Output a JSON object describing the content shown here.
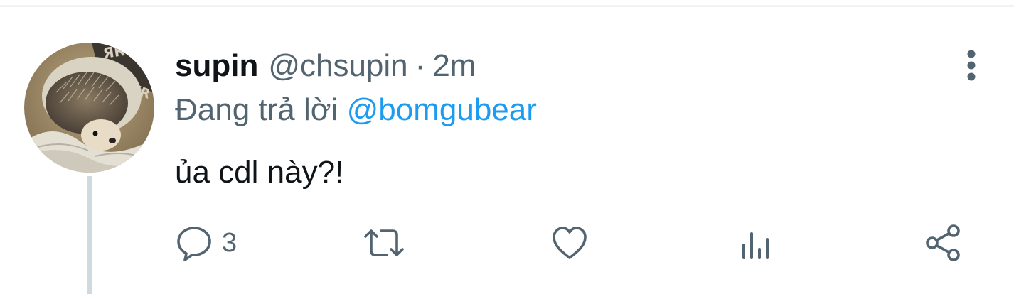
{
  "tweet": {
    "display_name": "supin",
    "handle": "@chsupin",
    "separator": "·",
    "time": "2m",
    "reply_prefix": "Đang trả lời",
    "reply_to": "@bomgubear",
    "text": "ủa cdl này?!"
  },
  "actions": {
    "reply": {
      "icon": "reply-icon",
      "count": "3"
    },
    "retweet": {
      "icon": "retweet-icon"
    },
    "like": {
      "icon": "heart-icon"
    },
    "analytics": {
      "icon": "analytics-icon"
    },
    "share": {
      "icon": "share-icon"
    }
  },
  "menu": {
    "icon": "more-vertical-icon"
  },
  "colors": {
    "text_primary": "#0f1419",
    "text_secondary": "#536471",
    "link": "#1d9bf0",
    "icon": "#536471",
    "thread_line": "#cfd9de"
  }
}
